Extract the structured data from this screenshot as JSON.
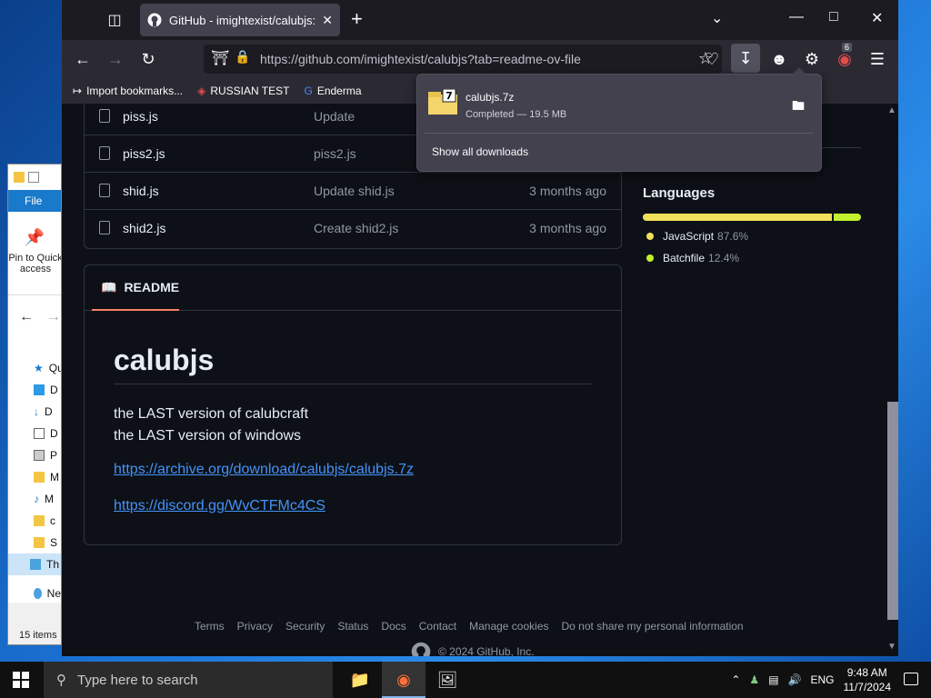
{
  "browser": {
    "tab_title": "GitHub - imightexist/calubjs: th",
    "url": "https://github.com/imightexist/calubjs?tab=readme-ov-file",
    "downloads_badge": "6",
    "bookmarks": [
      "Import bookmarks...",
      "RUSSIAN TEST",
      "Enderma"
    ]
  },
  "downloads": {
    "file_name": "calubjs.7z",
    "status": "Completed — 19.5 MB",
    "show_all": "Show all downloads"
  },
  "files": [
    {
      "name": "piss.js",
      "message": "Update",
      "time": ""
    },
    {
      "name": "piss2.js",
      "message": "piss2.js",
      "time": ""
    },
    {
      "name": "shid.js",
      "message": "Update shid.js",
      "time": "3 months ago"
    },
    {
      "name": "shid2.js",
      "message": "Create shid2.js",
      "time": "3 months ago"
    }
  ],
  "readme": {
    "tab_label": "README",
    "title": "calubjs",
    "line1": "the LAST version of calubcraft",
    "line2": "the LAST version of windows",
    "link1": "https://archive.org/download/calubjs/calubjs.7z",
    "link2": "https://discord.gg/WvCTFMc4CS"
  },
  "languages": {
    "title": "Languages",
    "items": [
      {
        "name": "JavaScript",
        "pct": "87.6%",
        "color": "#f1e05a",
        "share": 87.6
      },
      {
        "name": "Batchfile",
        "pct": "12.4%",
        "color": "#c1f12e",
        "share": 12.4
      }
    ]
  },
  "footer": {
    "links": [
      "Terms",
      "Privacy",
      "Security",
      "Status",
      "Docs",
      "Contact",
      "Manage cookies",
      "Do not share my personal information"
    ],
    "copyright": "© 2024 GitHub, Inc."
  },
  "explorer": {
    "file_tab": "File",
    "pin_label": "Pin to Quick access",
    "items": [
      "Qu",
      "D",
      "D",
      "D",
      "P",
      "M",
      "M",
      "c",
      "S",
      "Th",
      "Ne"
    ],
    "status": "15 items"
  },
  "taskbar": {
    "search_placeholder": "Type here to search",
    "lang": "ENG",
    "time": "9:48 AM",
    "date": "11/7/2024"
  }
}
